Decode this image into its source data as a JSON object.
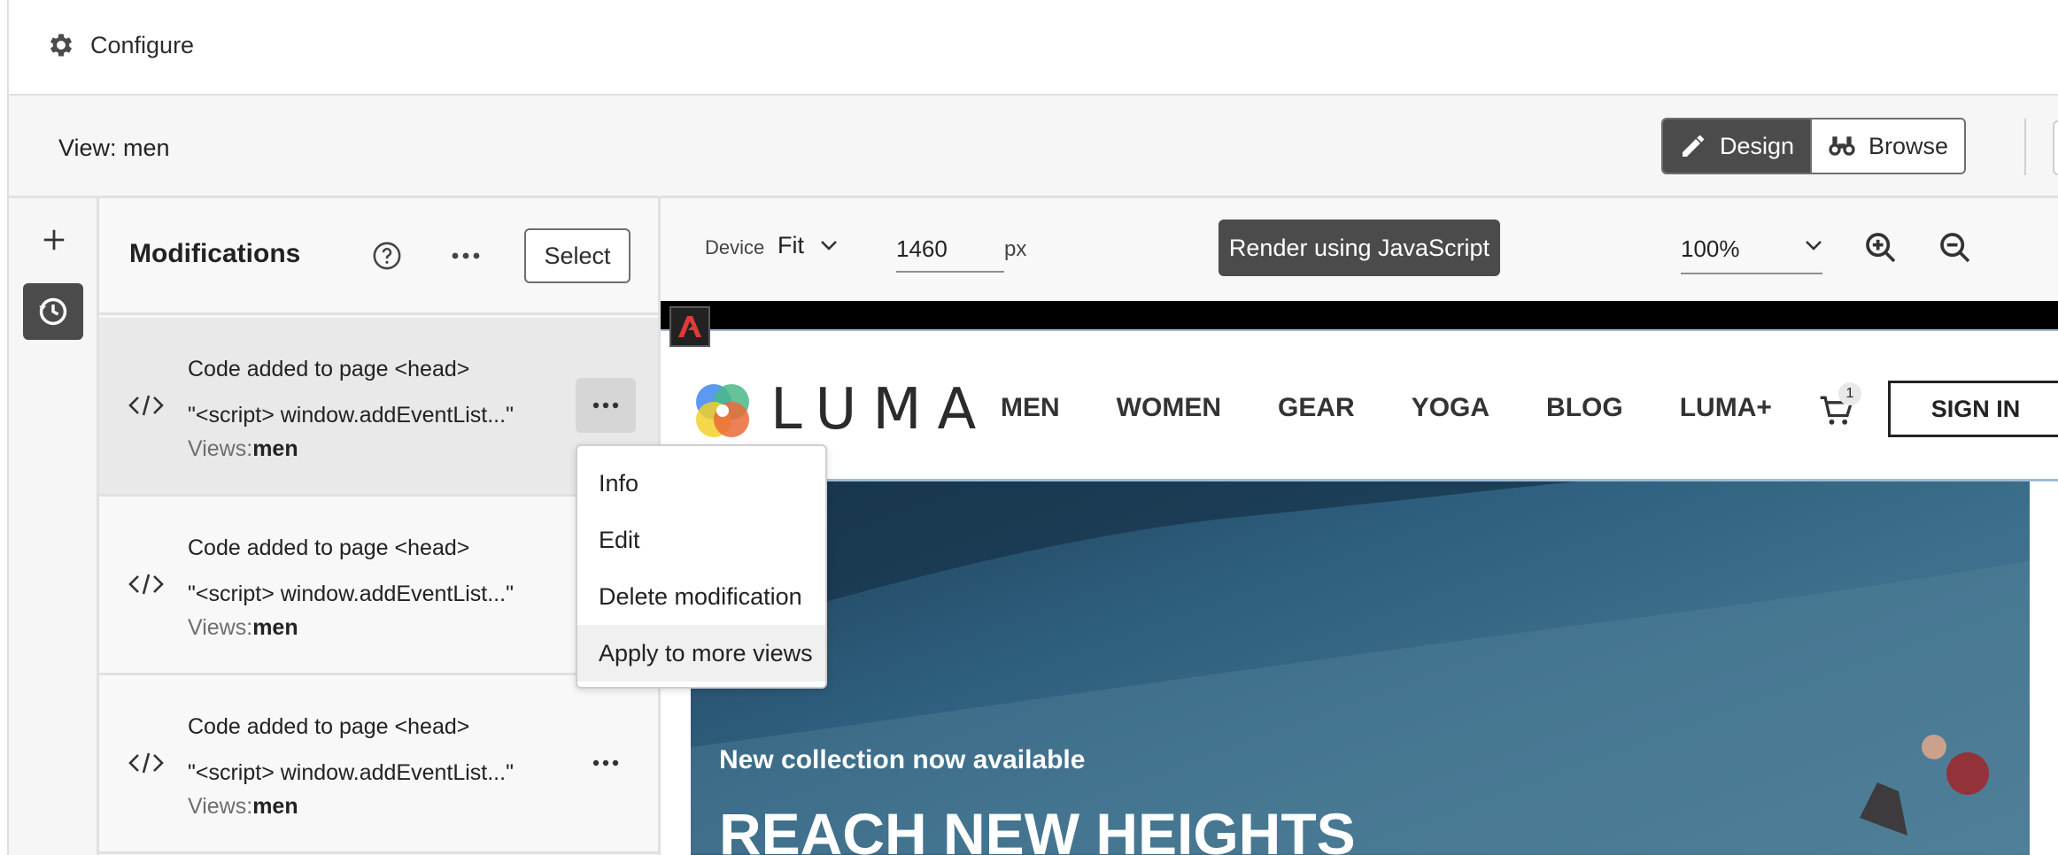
{
  "topbar": {
    "configure_label": "Configure"
  },
  "viewbar": {
    "view_label": "View: men",
    "design_label": "Design",
    "browse_label": "Browse"
  },
  "modifications": {
    "title": "Modifications",
    "select_label": "Select",
    "items": [
      {
        "line1": "Code added to page <head>",
        "line2": "\"<script> window.addEventList...\"",
        "views_prefix": "Views:",
        "views_value": "men"
      },
      {
        "line1": "Code added to page <head>",
        "line2": "\"<script> window.addEventList...\"",
        "views_prefix": "Views:",
        "views_value": "men"
      },
      {
        "line1": "Code added to page <head>",
        "line2": "\"<script> window.addEventList...\"",
        "views_prefix": "Views:",
        "views_value": "men"
      }
    ]
  },
  "context_menu": {
    "items": [
      "Info",
      "Edit",
      "Delete modification",
      "Apply to more views"
    ]
  },
  "preview_toolbar": {
    "device_label": "Device",
    "device_value": "Fit",
    "width_value": "1460",
    "width_unit": "px",
    "render_label": "Render using JavaScript",
    "zoom_value": "100%"
  },
  "site": {
    "brand": "LUMA",
    "nav": [
      "MEN",
      "WOMEN",
      "GEAR",
      "YOGA",
      "BLOG",
      "LUMA+"
    ],
    "cart_count": "1",
    "signin_label": "SIGN IN",
    "hero_sub": "New collection now available",
    "hero_title": "REACH NEW HEIGHTS"
  },
  "colors": {
    "dark_button": "#4b4b4b",
    "accent_blue": "#1473e6",
    "hero_blue": "#2e5f7e"
  }
}
